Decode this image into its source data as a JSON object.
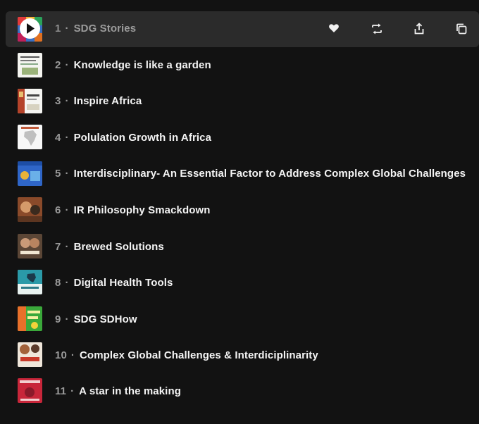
{
  "colors": {
    "background": "#121212",
    "active_row": "#2b2b2b",
    "text": "#f4f4f4",
    "muted": "#9a9a9a"
  },
  "actions": {
    "like_icon": "heart-icon",
    "repost_icon": "repost-icon",
    "share_icon": "share-icon",
    "copy_icon": "copy-icon"
  },
  "tracks": [
    {
      "num": "1",
      "sep": "·",
      "title": "SDG Stories",
      "thumb": "sdg-stories-artwork"
    },
    {
      "num": "2",
      "sep": "·",
      "title": "Knowledge is like a garden",
      "thumb": "knowledge-garden-artwork"
    },
    {
      "num": "3",
      "sep": "·",
      "title": "Inspire Africa",
      "thumb": "inspire-africa-artwork"
    },
    {
      "num": "4",
      "sep": "·",
      "title": "Polulation Growth in Africa",
      "thumb": "population-africa-artwork"
    },
    {
      "num": "5",
      "sep": "·",
      "title": "Interdisciplinary- An Essential Factor to Address Complex Global Challenges",
      "thumb": "interdisciplinary-artwork"
    },
    {
      "num": "6",
      "sep": "·",
      "title": "IR Philosophy Smackdown",
      "thumb": "ir-philosophy-artwork"
    },
    {
      "num": "7",
      "sep": "·",
      "title": "Brewed Solutions",
      "thumb": "brewed-solutions-artwork"
    },
    {
      "num": "8",
      "sep": "·",
      "title": "Digital Health Tools",
      "thumb": "digital-health-artwork"
    },
    {
      "num": "9",
      "sep": "·",
      "title": "SDG SDHow",
      "thumb": "sdg-sdhow-artwork"
    },
    {
      "num": "10",
      "sep": "·",
      "title": "Complex Global Challenges & Interdiciplinarity",
      "thumb": "complex-challenges-artwork"
    },
    {
      "num": "11",
      "sep": "·",
      "title": "A star in the making",
      "thumb": "star-making-artwork"
    }
  ]
}
